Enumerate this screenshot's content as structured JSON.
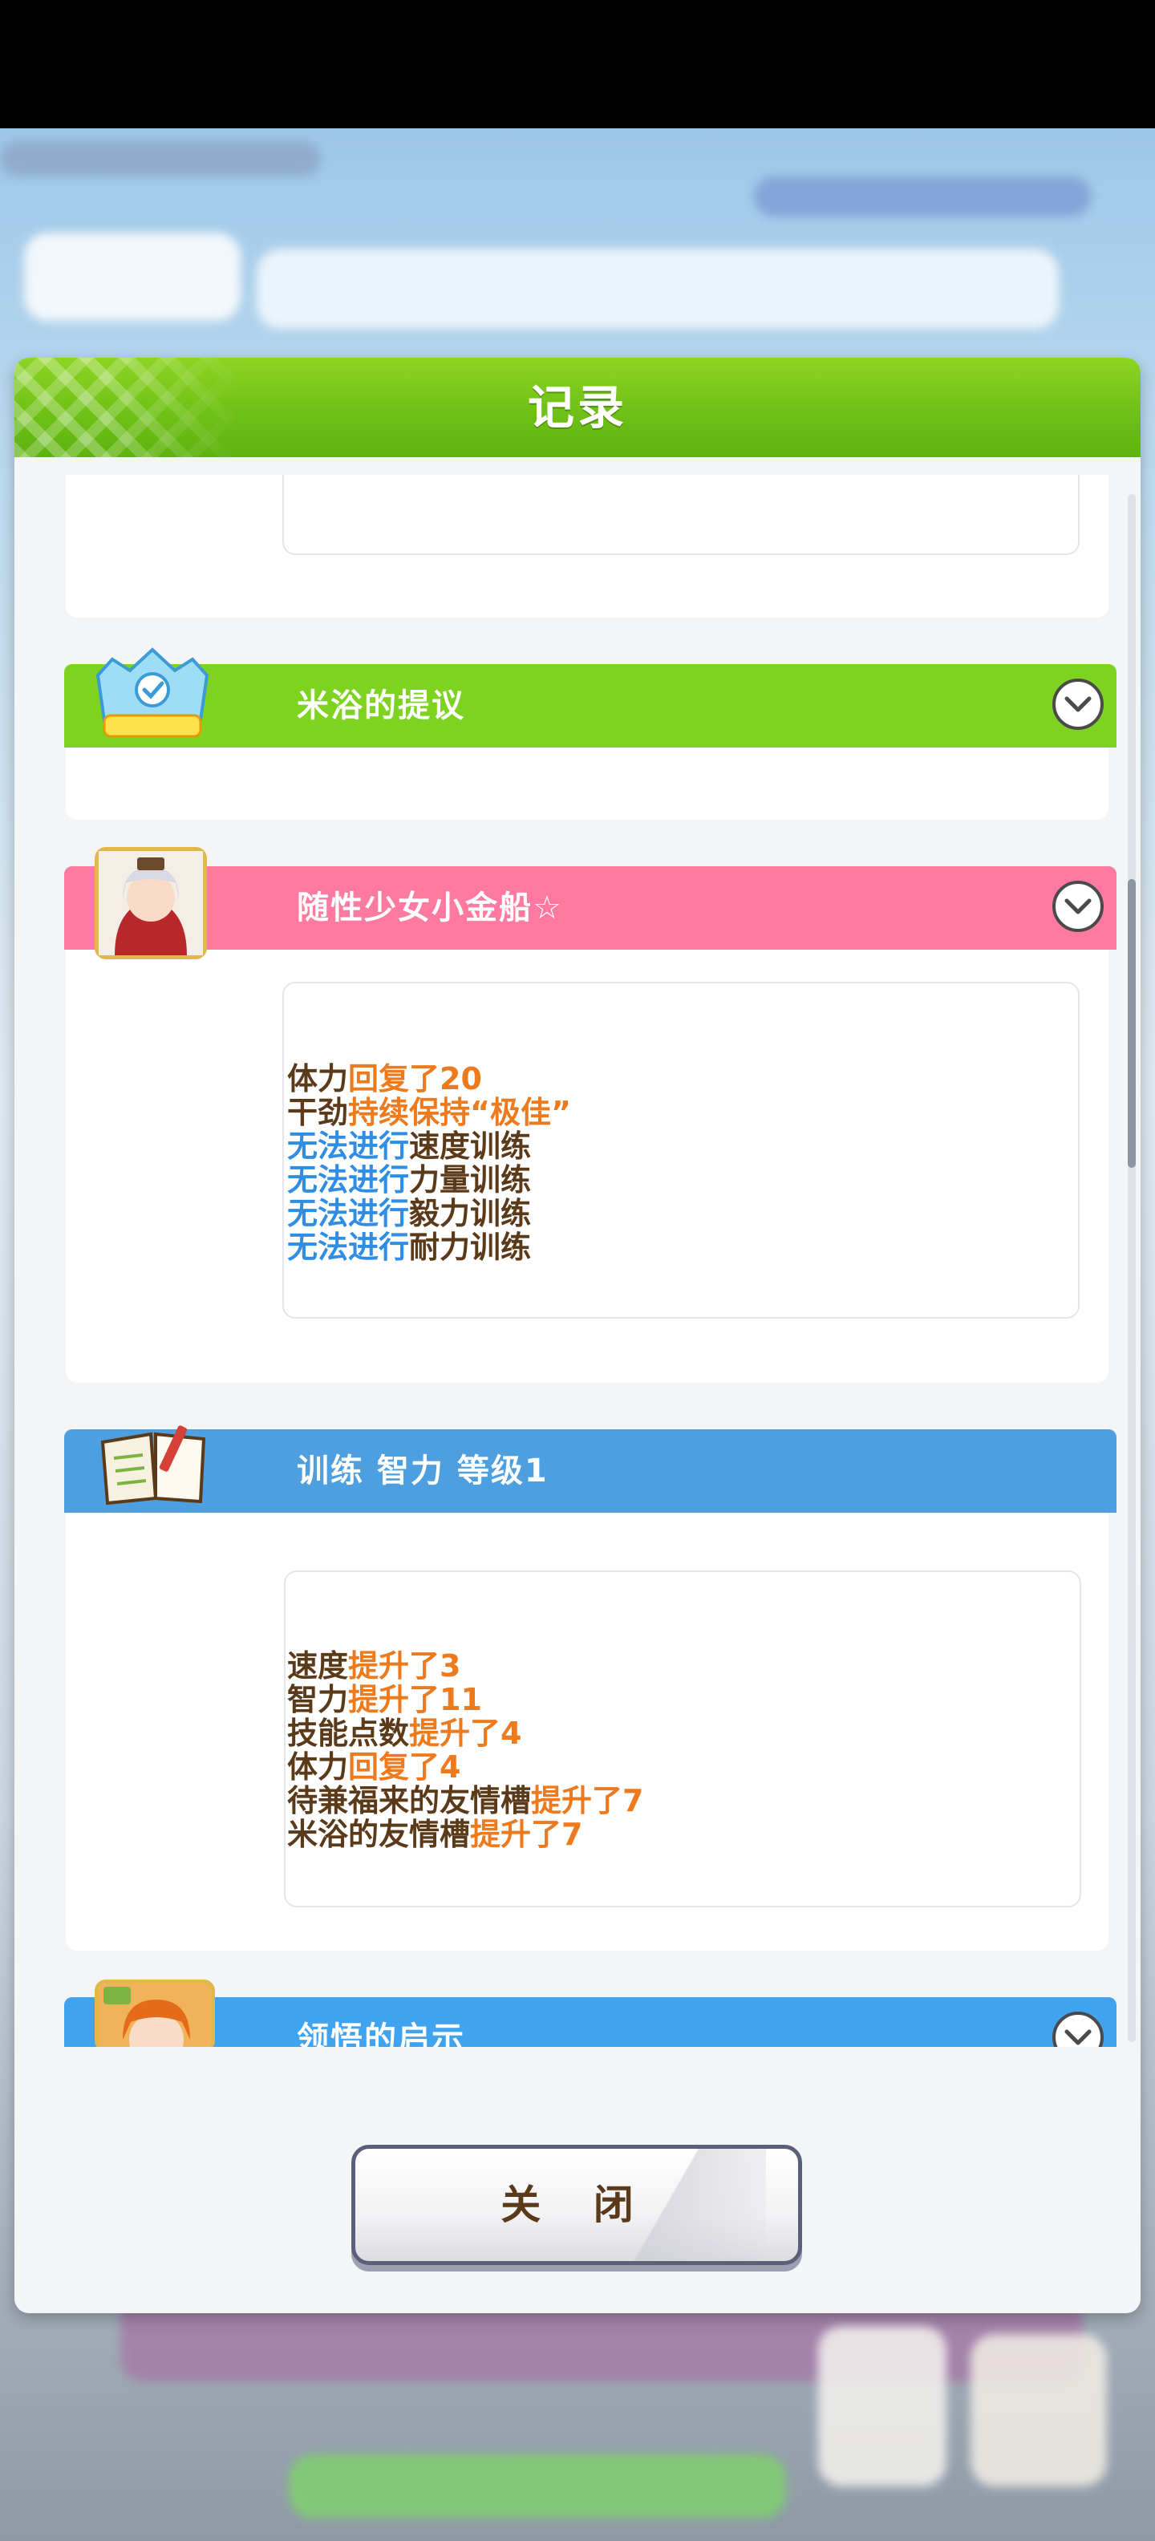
{
  "modal": {
    "title": "记录",
    "close_label": "关 闭"
  },
  "entries": [
    {
      "title": "米浴的提议",
      "bar_color": "#7ed321",
      "icon": "youth-cup-badge-icon"
    },
    {
      "title": "随性少女小金船☆",
      "bar_color": "#ff79a1",
      "icon": "gold-ship-portrait-icon",
      "lines": [
        {
          "parts": [
            "体力",
            "回复了20"
          ]
        },
        {
          "parts": [
            "干劲",
            "持续保持“极佳”"
          ]
        },
        {
          "parts": [
            "无法进行",
            "速度训练"
          ]
        },
        {
          "parts": [
            "无法进行",
            "力量训练"
          ]
        },
        {
          "parts": [
            "无法进行",
            "毅力训练"
          ]
        },
        {
          "parts": [
            "无法进行",
            "耐力训练"
          ]
        }
      ]
    },
    {
      "title": "训练 智力 等级1",
      "bar_color": "#4d9fe0",
      "icon": "training-notebook-icon",
      "lines": [
        {
          "parts": [
            "速度",
            "提升了3"
          ]
        },
        {
          "parts": [
            "智力",
            "提升了11"
          ]
        },
        {
          "parts": [
            "技能点数",
            "提升了4"
          ]
        },
        {
          "parts": [
            "体力",
            "回复了4"
          ]
        },
        {
          "parts": [
            "待兼福来的友情槽",
            "提升了7"
          ]
        },
        {
          "parts": [
            "米浴的友情槽",
            "提升了7"
          ]
        }
      ]
    },
    {
      "title": "领悟的启示",
      "bar_color": "#3fa3f0",
      "icon": "character-portrait-icon"
    }
  ],
  "colors": {
    "header_green": "#6fc116",
    "highlight_orange": "#ee7a1e",
    "highlight_blue": "#2f8de4",
    "text_brown": "#5b3a1a"
  }
}
